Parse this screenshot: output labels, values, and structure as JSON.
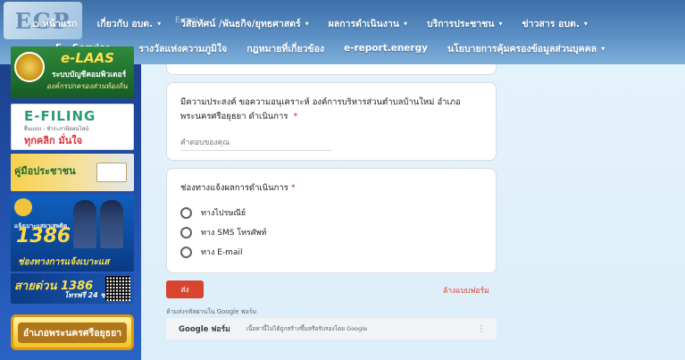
{
  "nav": {
    "row1": [
      {
        "label": "หน้าแรก",
        "caret": false
      },
      {
        "label": "เกี่ยวกับ อบต.",
        "caret": true
      },
      {
        "label": "วิสัยทัศน์ /พันธกิจ/ยุทธศาสตร์",
        "caret": true
      },
      {
        "label": "ผลการดำเนินงาน",
        "caret": true
      },
      {
        "label": "บริการประชาชน",
        "caret": true
      },
      {
        "label": "ข่าวสาร อบต.",
        "caret": true
      }
    ],
    "row2": [
      {
        "label": "E - Service",
        "caret": true
      },
      {
        "label": "รางวัลแห่งความภูมิใจ",
        "caret": false
      },
      {
        "label": "กฎหมายที่เกี่ยวข้อง",
        "caret": false
      },
      {
        "label": "e-report.energy",
        "caret": false
      },
      {
        "label": "นโยบายการคุ้มครองข้อมูลส่วนบุคคล",
        "caret": true
      }
    ],
    "ghost_text": "E-mai",
    "logo_text": "EGP",
    "caret_glyph": "▾",
    "home_glyph": "⌂"
  },
  "sidebar": {
    "laas": {
      "title": "e-LAAS",
      "line1": "ระบบบัญชีคอมพิวเตอร์",
      "line2": "องค์กรปกครองส่วนท้องถิ่น"
    },
    "efiling": {
      "title": "E-FILING",
      "line1": "ยื่นแบบ - ชำระภาษีออนไลน์",
      "line2": "ทุกคลิก มั่นใจ"
    },
    "manual": {
      "title": "คู่มือประชาชน"
    },
    "report": {
      "line0": "แจ้งเบาะแสยาเสพติด",
      "number": "1386",
      "line2": "ช่องทางการแจ้งเบาะแส"
    },
    "hotline": {
      "title": "สายด่วน 1386",
      "sub": "โทรฟรี 24 ชม."
    },
    "district": {
      "label": "อำเภอพระนครศรีอยุธยา"
    }
  },
  "form": {
    "q1": {
      "title": "มีความประสงค์ ขอความอนุเคราะห์ องค์การบริหารส่วนตำบลบ้านใหม่ อำเภอพระนครศรีอยุธยา ดำเนินการ",
      "required_mark": "*",
      "placeholder": "คำตอบของคุณ"
    },
    "q2": {
      "title": "ช่องทางแจ้งผลการดำเนินการ",
      "required_mark": "*",
      "options": [
        "ทางไปรษณีย์",
        "ทาง SMS โทรศัพท์",
        "ทาง E-mail"
      ]
    },
    "submit_label": "ส่ง",
    "clear_label": "ล้างแบบฟอร์ม",
    "warning": "ห้ามส่งรหัสผ่านใน Google ฟอร์ม",
    "footer": {
      "brand": "Google ฟอร์ม",
      "text": "เนื้อหานี้ไม่ได้ถูกสร้างขึ้นหรือรับรองโดย Google",
      "menu_glyph": "⋮"
    }
  },
  "colors": {
    "nav_bg": "#4f82bb",
    "accent": "#d9442e",
    "required": "#d93025",
    "sidebar_bg": "#1f4aa0"
  }
}
